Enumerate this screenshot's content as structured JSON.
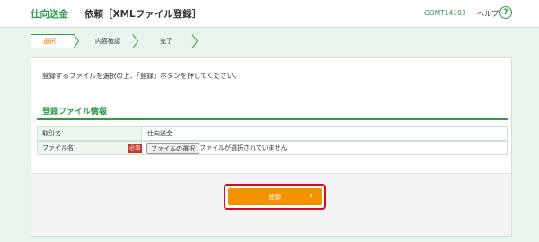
{
  "header": {
    "app_title": "仕向送金",
    "page_title": "依頼［XMLファイル登録］",
    "screen_id": "GOMT14103",
    "help_label": "ヘルプ",
    "help_icon_glyph": "?"
  },
  "steps": [
    {
      "label": "選択",
      "active": true
    },
    {
      "label": "内容確認",
      "active": false
    },
    {
      "label": "完了",
      "active": false
    }
  ],
  "main": {
    "instruction": "登録するファイルを選択の上、「登録」ボタンを押してください。",
    "section_title": "登録ファイル情報",
    "rows": [
      {
        "label": "取引名",
        "value": "仕向送金"
      },
      {
        "label": "ファイル名",
        "required_badge": "必須",
        "file_button_label": "ファイルの選択",
        "file_status": "ファイルが選択されていません"
      }
    ],
    "register_button_label": "登録",
    "register_chevron": "›"
  },
  "colors": {
    "brand_green": "#2e9a4a",
    "accent_orange": "#f39100",
    "highlight_red": "#d0101e",
    "background": "#e8f4ec"
  }
}
